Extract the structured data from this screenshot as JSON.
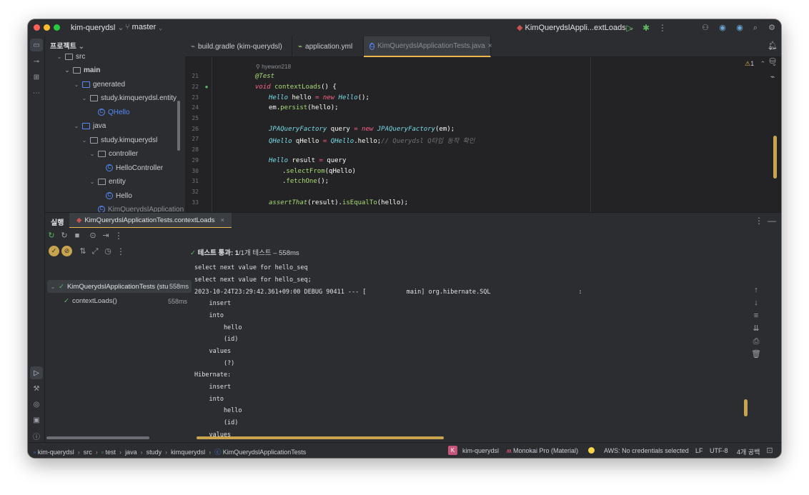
{
  "titlebar": {
    "project_name": "kim-querydsl",
    "branch": "master",
    "run_config": "KimQuerydslAppli...extLoads"
  },
  "project_panel": {
    "title": "프로젝트",
    "items": [
      {
        "label": "src"
      },
      {
        "label": "main"
      },
      {
        "label": "generated"
      },
      {
        "label": "study.kimquerydsl.entity"
      },
      {
        "label": "QHello"
      },
      {
        "label": "java"
      },
      {
        "label": "study.kimquerydsl"
      },
      {
        "label": "controller"
      },
      {
        "label": "HelloController"
      },
      {
        "label": "entity"
      },
      {
        "label": "Hello"
      },
      {
        "label": "KimQuerydslApplication"
      }
    ]
  },
  "editor": {
    "tabs": [
      {
        "label": "build.gradle (kim-querydsl)"
      },
      {
        "label": "application.yml"
      },
      {
        "label": "KimQuerydslApplicationTests.java"
      }
    ],
    "author": "hyewon218",
    "warning_count": "1",
    "line_numbers": [
      "21",
      "22",
      "23",
      "24",
      "25",
      "26",
      "27",
      "28",
      "29",
      "30",
      "31",
      "32",
      "33"
    ],
    "code": {
      "l21": "@Test",
      "l22_kw": "void",
      "l22_fn": "contextLoads",
      "l22_rest": "() {",
      "l23_ty": "Hello",
      "l23_a": " hello ",
      "l23_eq": "=",
      "l23_new": " new ",
      "l23_ty2": "Hello",
      "l23_rest": "();",
      "l24_a": "em.",
      "l24_fn": "persist",
      "l24_rest": "(hello);",
      "l26_ty": "JPAQueryFactory",
      "l26_a": " query ",
      "l26_eq": "=",
      "l26_new": " new ",
      "l26_ty2": "JPAQueryFactory",
      "l26_rest": "(em);",
      "l27_ty": "QHello",
      "l27_a": " qHello ",
      "l27_eq": "=",
      "l27_ty2": " QHello",
      "l27_rest": ".hello;",
      "l27_comment": "// Querydsl Q타입 동작 확인",
      "l29_ty": "Hello",
      "l29_a": " result ",
      "l29_eq": "=",
      "l29_rest": " query",
      "l30_a": ".",
      "l30_fn": "selectFrom",
      "l30_rest": "(qHello)",
      "l31_a": ".",
      "l31_fn": "fetchOne",
      "l31_rest": "();",
      "l33_fn": "assertThat",
      "l33_a": "(result).",
      "l33_fn2": "isEqualTo",
      "l33_rest": "(hello);"
    }
  },
  "run_panel": {
    "title": "실행",
    "tab": "KimQuerydslApplicationTests.contextLoads",
    "test_status_bold": "테스트 통과: 1",
    "test_status_rest": "/1개 테스트 – 558ms",
    "tree": [
      {
        "label": "KimQuerydslApplicationTests (stu",
        "time": "558ms"
      },
      {
        "label": "contextLoads()",
        "time": "558ms"
      }
    ],
    "console": [
      "select next value for hello_seq",
      "select next value for hello_seq;",
      "2023-10-24T23:29:42.361+09:00 DEBUG 90411 --- [           main] org.hibernate.SQL                        :",
      "    insert",
      "    into",
      "        hello",
      "        (id)",
      "    values",
      "        (?)",
      "Hibernate:",
      "    insert",
      "    into",
      "        hello",
      "        (id)",
      "    values"
    ]
  },
  "statusbar": {
    "breadcrumbs": [
      "kim-querydsl",
      "src",
      "test",
      "java",
      "study",
      "kimquerydsl",
      "KimQuerydslApplicationTests"
    ],
    "project_badge": "K",
    "project": "kim-querydsl",
    "theme": "Monokai Pro (Material)",
    "aws": "AWS: No credentials selected",
    "line_sep": "LF",
    "encoding": "UTF-8",
    "indent": "4개 공백"
  },
  "colors": {
    "accent": "#f0b84a",
    "pass_green": "#5fb865",
    "keyword": "#ff6188",
    "type": "#78dce8",
    "function": "#a9dc76"
  }
}
